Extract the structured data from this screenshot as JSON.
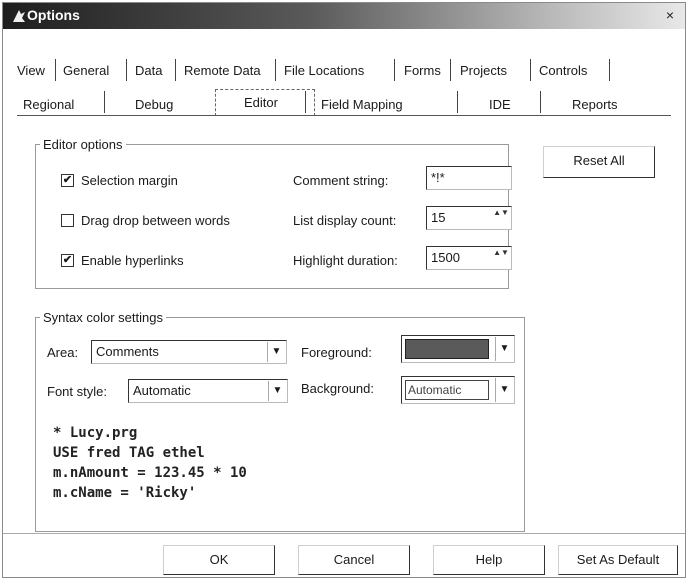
{
  "window": {
    "title": "Options",
    "close": "×"
  },
  "tabs": {
    "row1": [
      "View",
      "General",
      "Data",
      "Remote Data",
      "File Locations",
      "Forms",
      "Projects",
      "Controls"
    ],
    "row2": [
      "Regional",
      "Debug",
      "Editor",
      "Field Mapping",
      "IDE",
      "Reports"
    ],
    "active": "Editor"
  },
  "editor_options": {
    "legend": "Editor options",
    "selection_margin": {
      "label": "Selection margin",
      "checked": true
    },
    "drag_drop": {
      "label": "Drag drop between words",
      "checked": false
    },
    "hyperlinks": {
      "label": "Enable hyperlinks",
      "checked": true
    },
    "comment_string": {
      "label": "Comment string:",
      "value": "*!*"
    },
    "list_display_count": {
      "label": "List display count:",
      "value": "15"
    },
    "highlight_duration": {
      "label": "Highlight duration:",
      "value": "1500"
    },
    "reset_all": "Reset All"
  },
  "syntax": {
    "legend": "Syntax color settings",
    "area": {
      "label": "Area:",
      "value": "Comments"
    },
    "font_style": {
      "label": "Font style:",
      "value": "Automatic"
    },
    "foreground": {
      "label": "Foreground:",
      "color": "#5a5a5a"
    },
    "background": {
      "label": "Background:",
      "value": "Automatic"
    },
    "preview": [
      "* Lucy.prg",
      "USE fred TAG ethel",
      "m.nAmount = 123.45 * 10",
      "m.cName = 'Ricky'"
    ]
  },
  "buttons": {
    "ok": "OK",
    "cancel": "Cancel",
    "help": "Help",
    "set_default": "Set As Default"
  },
  "icons": {
    "check": "✔",
    "spin": "▲▼",
    "dropdown": "▼"
  }
}
